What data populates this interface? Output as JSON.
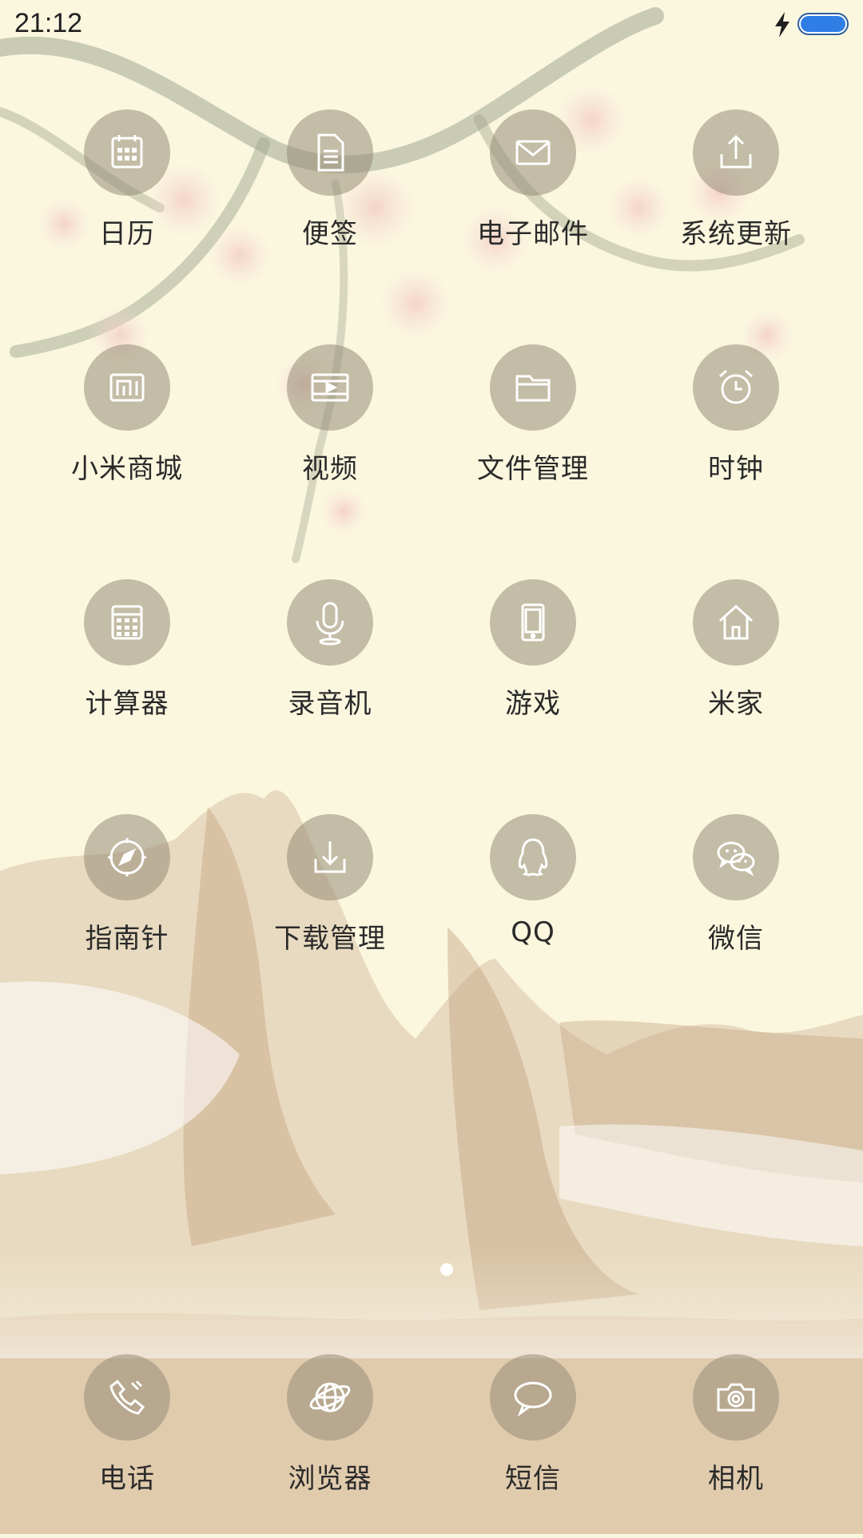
{
  "status_bar": {
    "time": "21:12",
    "icons": [
      "charging-icon",
      "battery-icon"
    ],
    "battery_color": "#2f7ee6"
  },
  "home_grid": {
    "rows": [
      [
        {
          "label": "日历",
          "icon": "calendar-icon"
        },
        {
          "label": "便签",
          "icon": "notes-icon"
        },
        {
          "label": "电子邮件",
          "icon": "mail-icon"
        },
        {
          "label": "系统更新",
          "icon": "upload-icon"
        }
      ],
      [
        {
          "label": "小米商城",
          "icon": "mi-store-icon"
        },
        {
          "label": "视频",
          "icon": "video-icon"
        },
        {
          "label": "文件管理",
          "icon": "folder-icon"
        },
        {
          "label": "时钟",
          "icon": "alarm-clock-icon"
        }
      ],
      [
        {
          "label": "计算器",
          "icon": "calculator-icon"
        },
        {
          "label": "录音机",
          "icon": "microphone-icon"
        },
        {
          "label": "游戏",
          "icon": "tablet-icon"
        },
        {
          "label": "米家",
          "icon": "home-icon"
        }
      ],
      [
        {
          "label": "指南针",
          "icon": "compass-icon"
        },
        {
          "label": "下载管理",
          "icon": "download-icon"
        },
        {
          "label": "QQ",
          "icon": "qq-penguin-icon"
        },
        {
          "label": "微信",
          "icon": "wechat-icon"
        }
      ]
    ]
  },
  "page_indicator": {
    "current": 1,
    "total": 1
  },
  "dock": {
    "items": [
      {
        "label": "电话",
        "icon": "phone-icon"
      },
      {
        "label": "浏览器",
        "icon": "globe-icon"
      },
      {
        "label": "短信",
        "icon": "chat-bubble-icon"
      },
      {
        "label": "相机",
        "icon": "camera-icon"
      }
    ]
  },
  "colors": {
    "background": "#fbf7df",
    "icon_circle": "#968c76",
    "label": "#2a2a2a"
  }
}
